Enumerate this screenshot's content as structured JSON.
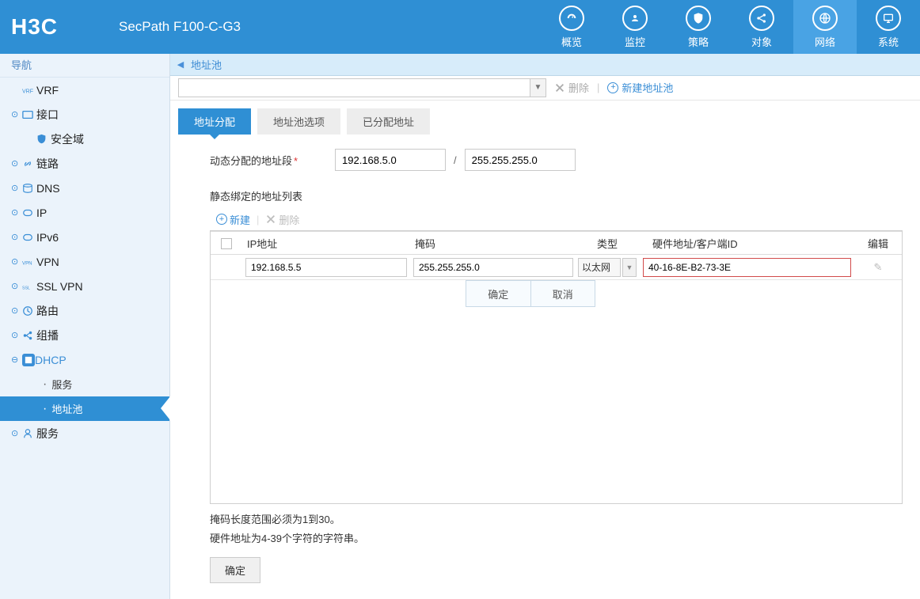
{
  "brand": "H3C",
  "device_name": "SecPath F100-C-G3",
  "topnav": {
    "items": [
      {
        "label": "概览",
        "key": "overview"
      },
      {
        "label": "监控",
        "key": "monitor"
      },
      {
        "label": "策略",
        "key": "policy"
      },
      {
        "label": "对象",
        "key": "object"
      },
      {
        "label": "网络",
        "key": "network"
      },
      {
        "label": "系统",
        "key": "system"
      }
    ],
    "active_key": "network"
  },
  "sidebar": {
    "title": "导航",
    "items": [
      {
        "label": "VRF",
        "icon": "vrf",
        "expandable": false
      },
      {
        "label": "接口",
        "icon": "interface",
        "expandable": true,
        "children": [
          {
            "label": "安全域",
            "icon": "shield"
          }
        ]
      },
      {
        "label": "链路",
        "icon": "link",
        "expandable": true
      },
      {
        "label": "DNS",
        "icon": "dns",
        "expandable": true
      },
      {
        "label": "IP",
        "icon": "ip",
        "expandable": true
      },
      {
        "label": "IPv6",
        "icon": "ipv6",
        "expandable": true
      },
      {
        "label": "VPN",
        "icon": "vpn",
        "expandable": true
      },
      {
        "label": "SSL VPN",
        "icon": "sslvpn",
        "expandable": true
      },
      {
        "label": "路由",
        "icon": "route",
        "expandable": true
      },
      {
        "label": "组播",
        "icon": "multicast",
        "expandable": true
      },
      {
        "label": "DHCP",
        "icon": "dhcp",
        "expandable": true,
        "expanded": true,
        "children": [
          {
            "label": "服务"
          },
          {
            "label": "地址池",
            "active": true
          }
        ]
      },
      {
        "label": "服务",
        "icon": "service",
        "expandable": true
      }
    ]
  },
  "breadcrumb": "地址池",
  "toolbar": {
    "delete_label": "删除",
    "new_label": "新建地址池"
  },
  "tabs": [
    {
      "label": "地址分配",
      "active": true
    },
    {
      "label": "地址池选项"
    },
    {
      "label": "已分配地址"
    }
  ],
  "form": {
    "dynamic_range_label": "动态分配的地址段",
    "dynamic_ip": "192.168.5.0",
    "dynamic_mask": "255.255.255.0",
    "slash": "/"
  },
  "grid": {
    "title": "静态绑定的地址列表",
    "new_label": "新建",
    "delete_label": "删除",
    "columns": {
      "ip": "IP地址",
      "mask": "掩码",
      "type": "类型",
      "hw": "硬件地址/客户端ID",
      "edit": "编辑"
    },
    "row": {
      "ip": "192.168.5.5",
      "mask": "255.255.255.0",
      "type": "以太网",
      "hw": "40-16-8E-B2-73-3E"
    },
    "row_ok": "确定",
    "row_cancel": "取消"
  },
  "hints": {
    "mask": "掩码长度范围必须为1到30。",
    "hw": "硬件地址为4-39个字符的字符串。"
  },
  "submit_label": "确定"
}
